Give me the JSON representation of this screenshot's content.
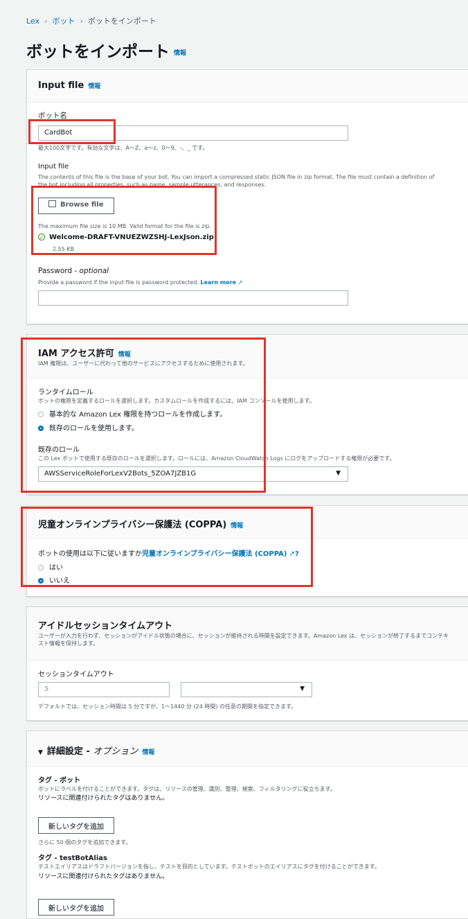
{
  "breadcrumb": {
    "lex": "Lex",
    "bot": "ボット",
    "current": "ボットをインポート"
  },
  "page_title": "ボットをインポート",
  "info_label": "情報",
  "input_file_panel": {
    "title": "Input file",
    "bot_name_label": "ボット名",
    "bot_name_value": "CardBot",
    "bot_name_hint": "最大100文字です。有効な文字は、A〜Z、a〜z、0〜9、-、_ です。",
    "input_file_label": "Input file",
    "input_file_desc": "The contents of this file is the base of your bot. You can import a compressed static JSON file in zip format. The file must contain a definition of the bot including all properties, such as name, sample utterances, and responses.",
    "browse_button": "Browse file",
    "max_size_text": "The maximum file size is 10 MB. Valid format for the file is zip.",
    "file_name": "Welcome-DRAFT-VNUEZWZSHJ-LexJson.zip",
    "file_size": "2.55 KB",
    "password_label": "Password - ",
    "password_optional": "optional",
    "password_desc": "Provide a password if the input file is password protected.",
    "learn_more": "Learn more"
  },
  "iam_panel": {
    "title": "IAM アクセス許可",
    "desc": "IAM 権限は、ユーザーに代わって他のサービスにアクセスするために使用されます。",
    "runtime_role_label": "ランタイムロール",
    "runtime_role_desc": "ボットの権限を定義するロールを選択します。カスタムロールを作成するには、IAM コンソールを使用します。",
    "option_create": "基本的な Amazon Lex 権限を持つロールを作成します。",
    "option_existing": "既存のロールを使用します。",
    "existing_role_label": "既存のロール",
    "existing_role_desc": "この Lex ボットで使用する既存のロールを選択します。ロールには、Amazon CloudWatch Logs にログをアップロードする権限が必要です。",
    "existing_role_value": "AWSServiceRoleForLexV2Bots_5ZOA7JZB1G"
  },
  "coppa_panel": {
    "title": "児童オンラインプライバシー保護法 (COPPA)",
    "question_prefix": "ボットの使用は以下に従いますか",
    "question_link": "児童オンラインプライバシー保護法 (COPPA)",
    "question_suffix": "?",
    "option_yes": "はい",
    "option_no": "いいえ"
  },
  "idle_panel": {
    "title": "アイドルセッションタイムアウト",
    "desc": "ユーザーが入力を行わず、セッションがアイドル状態の場合に、セッションが維持される時間を設定できます。Amazon Lex は、セッションが終了するまでコンテキスト情報を保持します。",
    "timeout_label": "セッションタイムアウト",
    "timeout_placeholder": "5",
    "timeout_hint": "デフォルトでは、セッション時間は 5 分ですが、1〜1440 分 (24 時間) の任意の期間を指定できます。"
  },
  "advanced_panel": {
    "title": "詳細設定 - ",
    "title_optional": "オプション",
    "tag_bot_label": "タグ - ボット",
    "tag_bot_desc": "ボットにラベルを付けることができます。タグは、リソースの管理、識別、整理、検索、フィルタリングに役立ちます。",
    "no_tags": "リソースに関連付けられたタグはありません。",
    "add_tag_button": "新しいタグを追加",
    "tag_limit": "さらに 50 個のタグを追加できます。",
    "tag_alias_label": "タグ - testBotAlias",
    "tag_alias_desc": "テストエイリアスはドラフトバージョンを指し、テストを目的としています。テストボットのエイリアスにタグを付けることができます。"
  }
}
